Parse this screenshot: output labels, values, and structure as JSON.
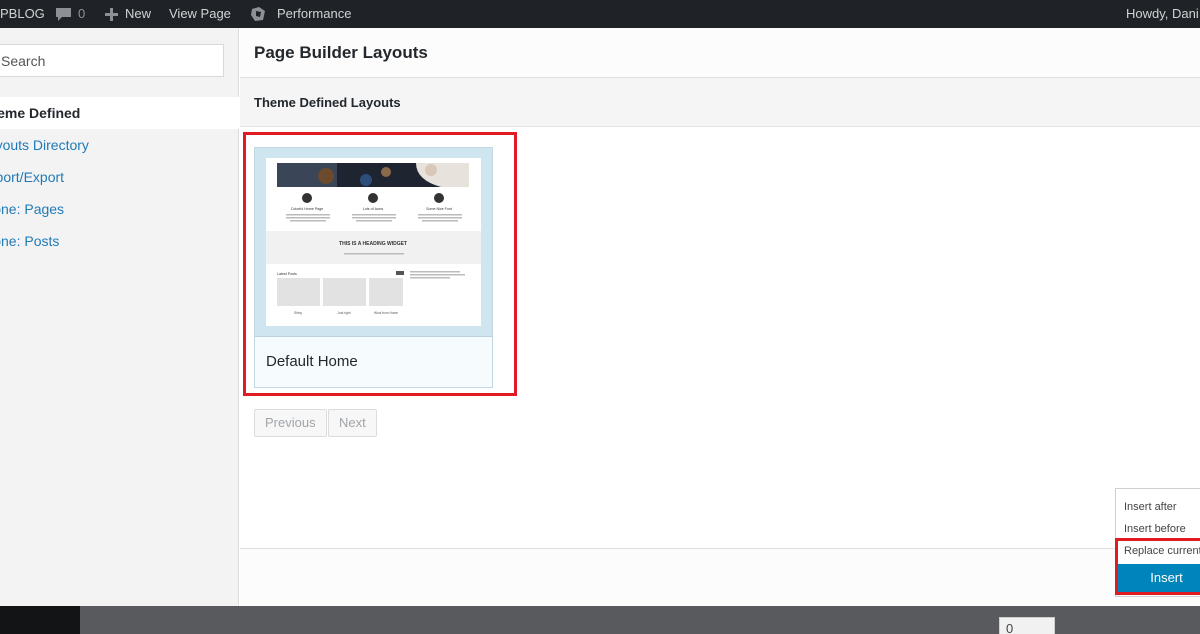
{
  "admin_bar": {
    "site_name": "PBLOG",
    "comments_count": "0",
    "new_label": "New",
    "view_page_label": "View Page",
    "performance_label": "Performance",
    "greeting": "Howdy, Dani"
  },
  "sidebar": {
    "search_placeholder": "Search",
    "items": [
      {
        "label": "Theme Defined"
      },
      {
        "label": "Layouts Directory"
      },
      {
        "label": "Import/Export"
      },
      {
        "label": "Clone: Pages"
      },
      {
        "label": "Clone: Posts"
      }
    ]
  },
  "main": {
    "title": "Page Builder Layouts",
    "section_title": "Theme Defined Layouts",
    "layouts": [
      {
        "name": "Default Home",
        "thumbnail": {
          "feature_titles": [
            "Colorful Home Page",
            "Lots of Icons",
            "Some Nice Font"
          ],
          "heading_widget": "THIS IS A HEADING WIDGET",
          "recent_label": "Latest Posts",
          "gallery_captions": [
            "Shiny",
            "Just right",
            "Work from Home"
          ]
        }
      }
    ],
    "previous_label": "Previous",
    "next_label": "Next"
  },
  "insert_menu": {
    "options": [
      "Insert after",
      "Insert before",
      "Replace current"
    ],
    "button_label": "Insert"
  },
  "background_page": {
    "field_value": "0"
  },
  "colors": {
    "admin_bar_bg": "#1f2327",
    "accent_blue": "#0085ba",
    "highlight_red": "#e01b24",
    "link_blue": "#1f7ab8"
  }
}
